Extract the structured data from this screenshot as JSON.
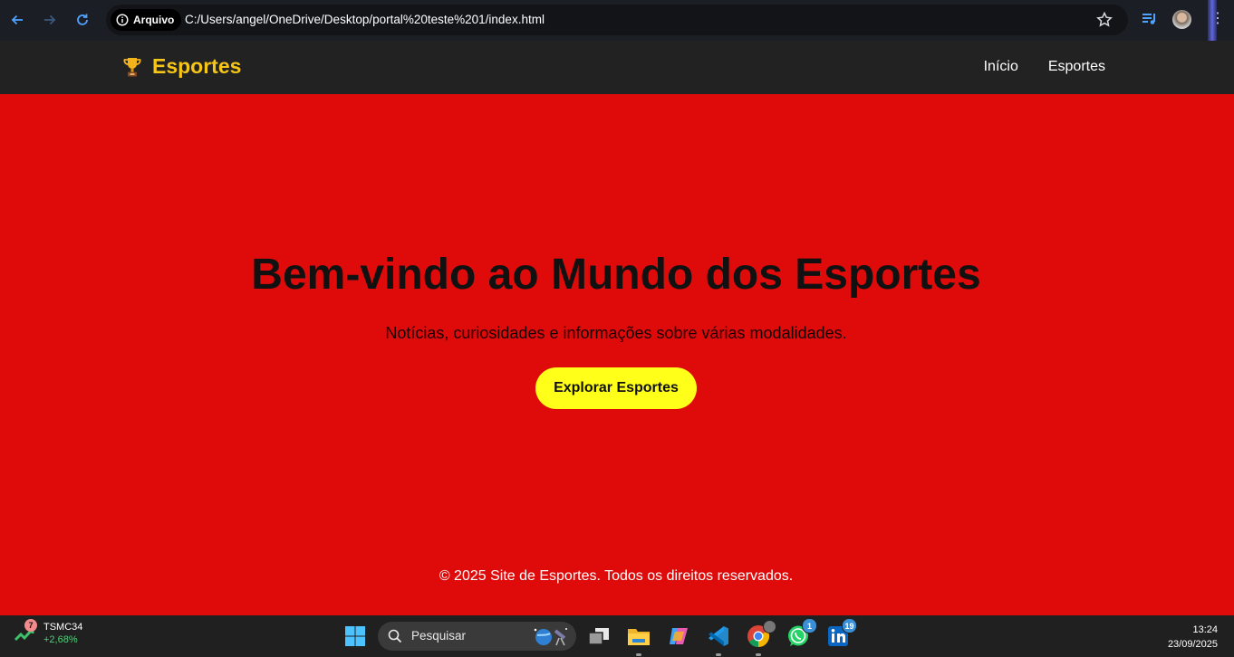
{
  "browser": {
    "security_chip": "Arquivo",
    "url": "C:/Users/angel/OneDrive/Desktop/portal%20teste%201/index.html"
  },
  "site": {
    "brand": "Esportes",
    "brand_icon": "trophy-icon",
    "nav": [
      "Início",
      "Esportes"
    ],
    "hero_title": "Bem-vindo ao Mundo dos Esportes",
    "hero_subtitle": "Notícias, curiosidades e informações sobre várias modalidades.",
    "cta": "Explorar Esportes",
    "footer": "© 2025 Site de Esportes. Todos os direitos reservados."
  },
  "taskbar": {
    "widget_badge": "7",
    "ticker_name": "TSMC34",
    "ticker_change": "+2,68%",
    "search_placeholder": "Pesquisar",
    "whatsapp_badge": "1",
    "linkedin_badge": "19",
    "time": "13:24",
    "date": "23/09/2025"
  },
  "colors": {
    "hero_bg": "#df0b0b",
    "header_bg": "#222222",
    "brand": "#f5c518",
    "cta_bg": "#ffff1a"
  }
}
